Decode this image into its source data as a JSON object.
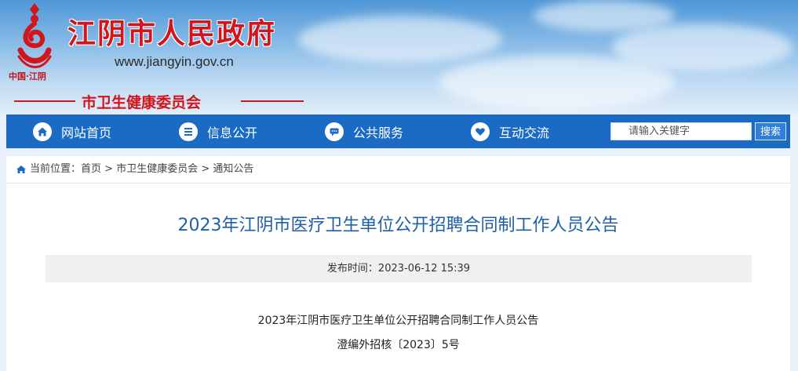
{
  "header": {
    "site_title": "江阴市人民政府",
    "site_url": "www.jiangyin.gov.cn",
    "logo_sub": "中国·江阴",
    "dept_name": "市卫生健康委员会",
    "brand_red": "#d2141b"
  },
  "nav": {
    "items": [
      {
        "label": "网站首页",
        "icon": "home-icon"
      },
      {
        "label": "信息公开",
        "icon": "list-icon"
      },
      {
        "label": "公共服务",
        "icon": "chat-icon"
      },
      {
        "label": "互动交流",
        "icon": "heart-icon"
      }
    ],
    "search_placeholder": "请输入关键字",
    "search_button": "搜索",
    "bar_color": "#1b6ac4"
  },
  "breadcrumb": {
    "prefix": "当前位置：",
    "items": [
      "首页",
      "市卫生健康委员会",
      "通知公告"
    ],
    "separator": " > "
  },
  "article": {
    "title": "2023年江阴市医疗卫生单位公开招聘合同制工作人员公告",
    "publish_label": "发布时间：",
    "publish_time": "2023-06-12 15:39",
    "body_title": "2023年江阴市医疗卫生单位公开招聘合同制工作人员公告",
    "doc_number": "澄编外招核〔2023〕5号",
    "title_color": "#1e5fa5"
  }
}
